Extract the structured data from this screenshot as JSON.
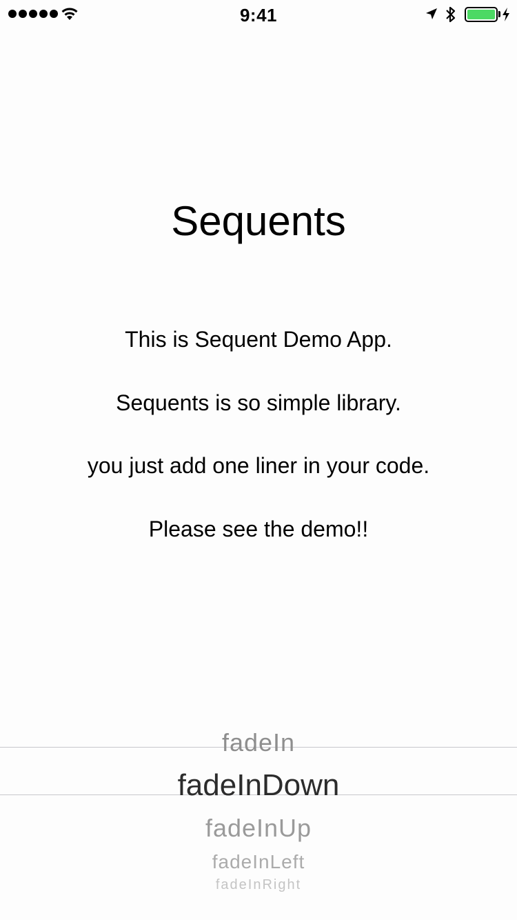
{
  "status_bar": {
    "time": "9:41",
    "signal_bars": 5,
    "battery_color": "#4cd964",
    "icons": [
      "wifi-icon",
      "location-icon",
      "bluetooth-icon",
      "battery-icon",
      "charging-icon"
    ]
  },
  "main": {
    "title": "Sequents",
    "lines": [
      "This is Sequent Demo App.",
      "Sequents is so simple library.",
      "you just add one liner in your code.",
      "Please see the demo!!"
    ]
  },
  "picker": {
    "selected": "fadeInDown",
    "items": [
      "fadeIn",
      "fadeInDown",
      "fadeInUp",
      "fadeInLeft",
      "fadeInRight"
    ]
  }
}
